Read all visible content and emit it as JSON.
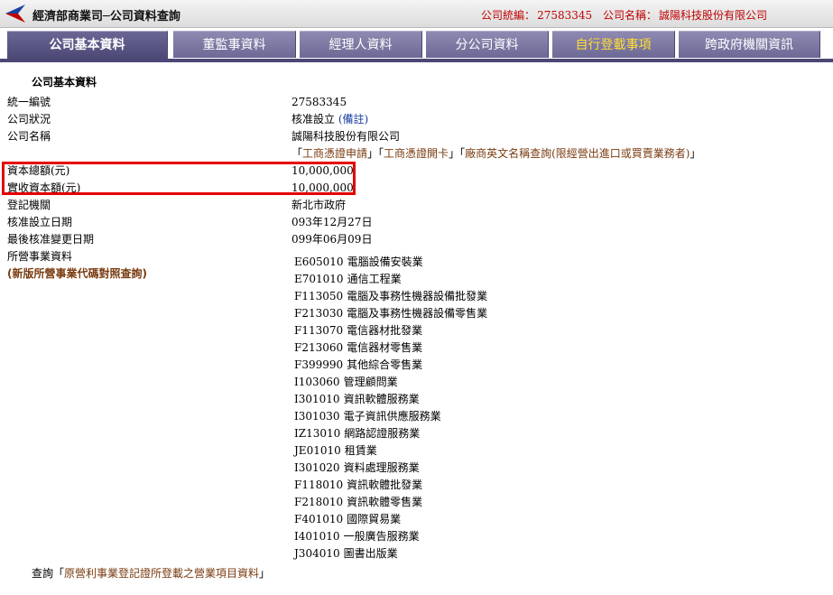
{
  "header": {
    "app_title": "經濟部商業司─公司資料查詢",
    "tax_id_label": "公司統編：",
    "tax_id": "27583345",
    "company_label": "公司名稱：",
    "company_name": "誠陽科技股份有限公司"
  },
  "tabs": [
    {
      "label": "公司基本資料",
      "active": true
    },
    {
      "label": "董監事資料"
    },
    {
      "label": "經理人資料"
    },
    {
      "label": "分公司資料"
    },
    {
      "label": "自行登載事項"
    },
    {
      "label": "跨政府機關資訊"
    }
  ],
  "section_title": "公司基本資料",
  "fields": {
    "unified_no": {
      "label": "統一編號",
      "value": "27583345"
    },
    "status": {
      "label": "公司狀況",
      "value": "核准設立",
      "note": "(備註)"
    },
    "name": {
      "label": "公司名稱",
      "value": "誠陽科技股份有限公司"
    },
    "name_links": [
      "「",
      "工商憑證申請",
      "」「",
      "工商憑證開卡",
      "」「",
      "廠商英文名稱查詢(限經營出進口或買賣業務者)",
      "」"
    ],
    "capital_total": {
      "label": "資本總額(元)",
      "value": "10,000,000"
    },
    "capital_paid": {
      "label": "實收資本額(元)",
      "value": "10,000,000"
    },
    "authority": {
      "label": "登記機關",
      "value": "新北市政府"
    },
    "approval_date": {
      "label": "核准設立日期",
      "value": "093年12月27日"
    },
    "last_change_date": {
      "label": "最後核准變更日期",
      "value": "099年06月09日"
    },
    "business": {
      "label": "所營事業資料",
      "sub_link": "(新版所營事業代碼對照查詢)"
    }
  },
  "business_items": [
    {
      "code": "E605010",
      "name": "電腦設備安裝業"
    },
    {
      "code": "E701010",
      "name": "通信工程業"
    },
    {
      "code": "F113050",
      "name": "電腦及事務性機器設備批發業"
    },
    {
      "code": "F213030",
      "name": "電腦及事務性機器設備零售業"
    },
    {
      "code": "F113070",
      "name": "電信器材批發業"
    },
    {
      "code": "F213060",
      "name": "電信器材零售業"
    },
    {
      "code": "F399990",
      "name": "其他綜合零售業"
    },
    {
      "code": "I103060",
      "name": "管理顧問業"
    },
    {
      "code": "I301010",
      "name": "資訊軟體服務業"
    },
    {
      "code": "I301030",
      "name": "電子資訊供應服務業"
    },
    {
      "code": "IZ13010",
      "name": "網路認證服務業"
    },
    {
      "code": "JE01010",
      "name": "租賃業"
    },
    {
      "code": "I301020",
      "name": "資料處理服務業"
    },
    {
      "code": "F118010",
      "name": "資訊軟體批發業"
    },
    {
      "code": "F218010",
      "name": "資訊軟體零售業"
    },
    {
      "code": "F401010",
      "name": "國際貿易業"
    },
    {
      "code": "I401010",
      "name": "一般廣告服務業"
    },
    {
      "code": "J304010",
      "name": "圖書出版業"
    }
  ],
  "query": {
    "prefix": "查詢「",
    "link": "原營利事業登記證所登載之營業項目資料",
    "suffix": "」"
  },
  "colors": {
    "accent": "#4c4876",
    "alert": "#e60000",
    "link": "#7a3b10"
  }
}
